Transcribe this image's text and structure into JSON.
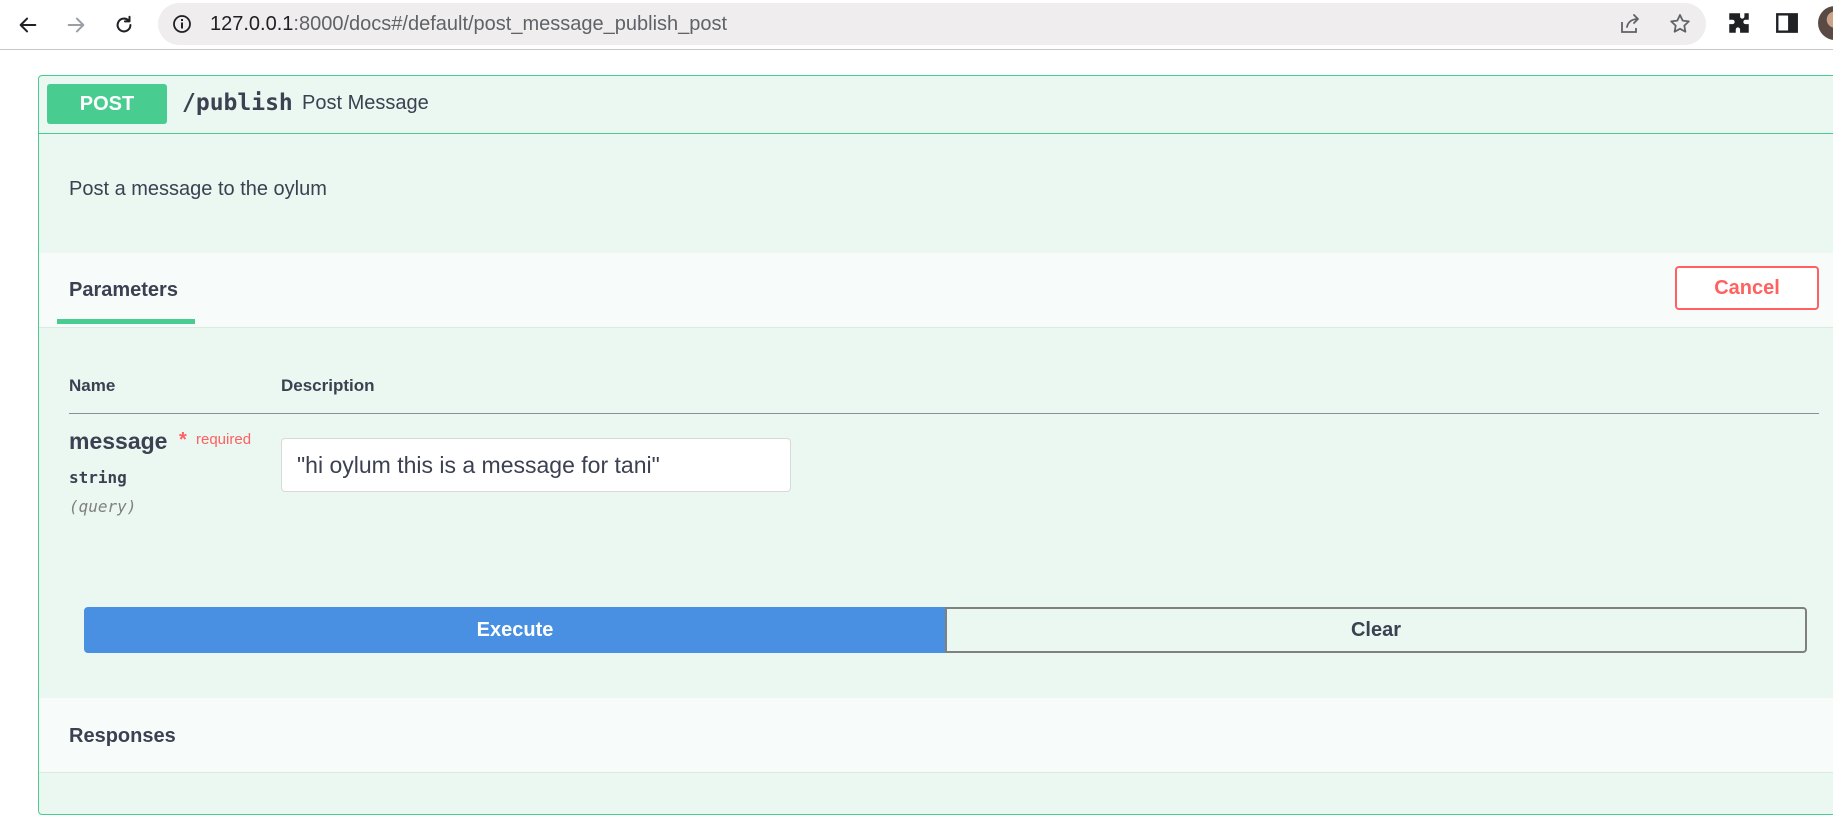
{
  "browser": {
    "url_host": "127.0.0.1",
    "url_rest": ":8000/docs#/default/post_message_publish_post",
    "back_icon": "back-arrow-icon",
    "forward_icon": "forward-arrow-icon",
    "reload_icon": "reload-icon",
    "info_icon": "info-icon",
    "share_icon": "share-icon",
    "star_icon": "star-icon",
    "extensions_icon": "puzzle-icon",
    "sidepanel_icon": "side-panel-icon"
  },
  "operation": {
    "method": "POST",
    "path": "/publish",
    "summary": "Post Message",
    "description": "Post a message to the oylum",
    "method_color": "#49cc90"
  },
  "parameters": {
    "tab_label": "Parameters",
    "cancel_label": "Cancel",
    "col_name": "Name",
    "col_description": "Description",
    "items": [
      {
        "name": "message",
        "required_star": "*",
        "required_label": "required",
        "type": "string",
        "in": "(query)",
        "value": "\"hi oylum this is a message for tani\""
      }
    ]
  },
  "actions": {
    "execute_label": "Execute",
    "clear_label": "Clear",
    "execute_color": "#4990e2"
  },
  "responses": {
    "title": "Responses"
  }
}
